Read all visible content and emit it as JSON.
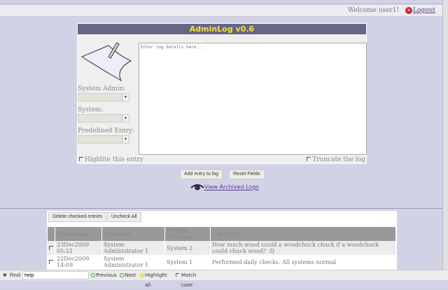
{
  "header": {
    "welcome": "Welcome user1!",
    "logout": "Logout"
  },
  "form": {
    "title": "AdminLog v0.6",
    "textarea_placeholder": "Enter log details here...",
    "system_admin_label": "System Admin:",
    "system_label": "System:",
    "predefined_label": "Predefined Entry:",
    "highlight_label": "Highlite this entry",
    "truncate_label": "Truncate the log",
    "add_button": "Add entry to log",
    "reset_button": "Reset Fields",
    "archive_link": "View Archived Logs"
  },
  "table": {
    "delete_button": "Delete checked entries",
    "uncheck_button": "Uncheck All",
    "columns": [
      "Timestamp",
      "SysAdmin",
      "System Affecting",
      "Log Entry"
    ],
    "rows": [
      {
        "timestamp": "23Dec2009 05:21",
        "sysadmin": "System Administrator 1",
        "system": "System 2",
        "entry": "How much wood could a woodchuck chuck if a woodchuck could chuck wood? :D"
      },
      {
        "timestamp": "22Dec2009 14:09",
        "sysadmin": "System Administrator 1",
        "system": "System 1",
        "entry": "Performed daily checks. All systems normal"
      }
    ]
  },
  "findbar": {
    "label": "Find:",
    "value": "help",
    "previous": "Previous",
    "next": "Next",
    "highlight": "Highlight all",
    "match_case": "Match case"
  }
}
